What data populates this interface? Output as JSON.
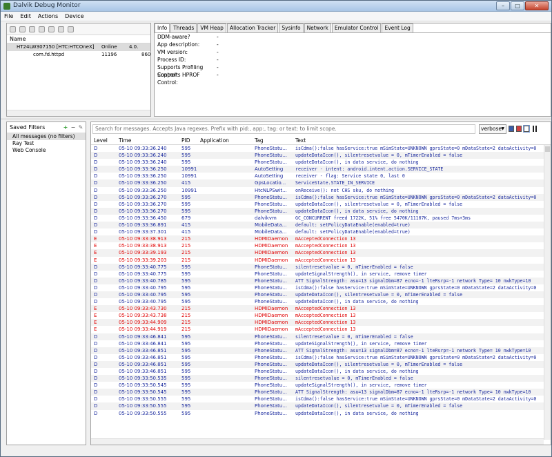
{
  "window": {
    "title": "Dalvik Debug Monitor",
    "buttons": [
      "–",
      "□",
      "✕"
    ]
  },
  "menu": [
    "File",
    "Edit",
    "Actions",
    "Device"
  ],
  "devices": {
    "header": "Name",
    "rows": [
      {
        "name": "HT24LW307150 [HTC:HTCOneX]",
        "status": "Online",
        "extra": "4.0.",
        "selected": true
      },
      {
        "name": "com.fd.httpd",
        "status": "11196",
        "extra": "860",
        "selected": false
      }
    ]
  },
  "tabs": [
    "Info",
    "Threads",
    "VM Heap",
    "Allocation Tracker",
    "Sysinfo",
    "Network",
    "Emulator Control",
    "Event Log"
  ],
  "info_props": [
    {
      "label": "DDM-aware?",
      "value": "-"
    },
    {
      "label": "App description:",
      "value": "-"
    },
    {
      "label": "VM version:",
      "value": "-"
    },
    {
      "label": "Process ID:",
      "value": "-"
    },
    {
      "label": "Supports Profiling Control:",
      "value": "-"
    },
    {
      "label": "Supports HPROF Control:",
      "value": "-"
    }
  ],
  "filters": {
    "title": "Saved Filters",
    "items": [
      "All messages (no filters)",
      "Ray Test",
      "Web Console"
    ]
  },
  "log": {
    "search_placeholder": "Search for messages. Accepts Java regexes. Prefix with pid:, app:, tag: or text: to limit scope.",
    "level_selected": "verbose",
    "columns": [
      "Level",
      "Time",
      "PID",
      "Application",
      "Tag",
      "Text"
    ],
    "colors": {
      "D": "#1a2a9e",
      "E": "#e00000"
    },
    "rows": [
      [
        "D",
        "05-10 09:33:36.240",
        "595",
        "",
        "PhoneStatu...",
        "isCdma():false hasService:true mSimState=UNKNOWN gprsState=0 mDataState=2 dataActivity=0"
      ],
      [
        "D",
        "05-10 09:33:36.240",
        "595",
        "",
        "PhoneStatu...",
        "updateDataIcon(), silentresetvalue = 0, mTimerEnabled = false"
      ],
      [
        "D",
        "05-10 09:33:36.240",
        "595",
        "",
        "PhoneStatu...",
        "updateDataIcon(), in data service, do nothing"
      ],
      [
        "D",
        "05-10 09:33:36.250",
        "10991",
        "",
        "AutoSetting",
        "receiver - intent: android.intent.action.SERVICE_STATE"
      ],
      [
        "D",
        "05-10 09:33:36.250",
        "10991",
        "",
        "AutoSetting",
        "receiver - flag: Service state 0, last 0"
      ],
      [
        "D",
        "05-10 09:33:36.250",
        "415",
        "",
        "GpsLocatio...",
        "ServiceState.STATE_IN_SERVICE"
      ],
      [
        "D",
        "05-10 09:33:36.250",
        "10991",
        "",
        "HtcNLPSwit...",
        "onReceive(): not CHS sku, do nothing"
      ],
      [
        "D",
        "05-10 09:33:36.270",
        "595",
        "",
        "PhoneStatu...",
        "isCdma():false hasService:true mSimState=UNKNOWN gprsState=0 mDataState=2 dataActivity=0"
      ],
      [
        "D",
        "05-10 09:33:36.270",
        "595",
        "",
        "PhoneStatu...",
        "updateDataIcon(), silentresetvalue = 0, mTimerEnabled = false"
      ],
      [
        "D",
        "05-10 09:33:36.270",
        "595",
        "",
        "PhoneStatu...",
        "updateDataIcon(), in data service, do nothing"
      ],
      [
        "D",
        "05-10 09:33:36.450",
        "679",
        "",
        "dalvikvm",
        "GC_CONCURRENT freed 1722K, 51% free 5470K/11107K, paused 7ms+3ms"
      ],
      [
        "D",
        "05-10 09:33:36.891",
        "415",
        "",
        "MobileData...",
        "default: setPolicyDataEnable(enabled=true)"
      ],
      [
        "D",
        "05-10 09:33:37.301",
        "415",
        "",
        "MobileData...",
        "default: setPolicyDataEnable(enabled=true)"
      ],
      [
        "E",
        "05-10 09:33:38.913",
        "215",
        "",
        "HDMIDaemon",
        "mAcceptedConnection 13"
      ],
      [
        "E",
        "05-10 09:33:38.913",
        "215",
        "",
        "HDMIDaemon",
        "mAcceptedConnection 13"
      ],
      [
        "E",
        "05-10 09:33:39.193",
        "215",
        "",
        "HDMIDaemon",
        "mAcceptedConnection 13"
      ],
      [
        "E",
        "05-10 09:33:39.203",
        "215",
        "",
        "HDMIDaemon",
        "mAcceptedConnection 13"
      ],
      [
        "D",
        "05-10 09:33:40.775",
        "595",
        "",
        "PhoneStatu...",
        "silentresetvalue = 0, mTimerEnabled = false"
      ],
      [
        "D",
        "05-10 09:33:40.775",
        "595",
        "",
        "PhoneStatu...",
        "updateSignalStrength(), in service, remove timer"
      ],
      [
        "D",
        "05-10 09:33:40.785",
        "595",
        "",
        "PhoneStatu...",
        "ATT SignalStrength: asu=13 signalDbm=87 ecno=-1 lteRsrp=-1 network Type= 10 nwkType=10"
      ],
      [
        "D",
        "05-10 09:33:40.795",
        "595",
        "",
        "PhoneStatu...",
        "isCdma():false hasService:true mSimState=UNKNOWN gprsState=0 mDataState=2 dataActivity=0"
      ],
      [
        "D",
        "05-10 09:33:40.795",
        "595",
        "",
        "PhoneStatu...",
        "updateDataIcon(), silentresetvalue = 0, mTimerEnabled = false"
      ],
      [
        "D",
        "05-10 09:33:40.795",
        "595",
        "",
        "PhoneStatu...",
        "updateDataIcon(), in data service, do nothing"
      ],
      [
        "E",
        "05-10 09:33:43.730",
        "215",
        "",
        "HDMIDaemon",
        "mAcceptedConnection 13"
      ],
      [
        "E",
        "05-10 09:33:43.738",
        "215",
        "",
        "HDMIDaemon",
        "mAcceptedConnection 13"
      ],
      [
        "E",
        "05-10 09:33:44.909",
        "215",
        "",
        "HDMIDaemon",
        "mAcceptedConnection 13"
      ],
      [
        "E",
        "05-10 09:33:44.919",
        "215",
        "",
        "HDMIDaemon",
        "mAcceptedConnection 13"
      ],
      [
        "D",
        "05-10 09:33:46.841",
        "595",
        "",
        "PhoneStatu...",
        "silentresetvalue = 0, mTimerEnabled = false"
      ],
      [
        "D",
        "05-10 09:33:46.841",
        "595",
        "",
        "PhoneStatu...",
        "updateSignalStrength(), in service, remove timer"
      ],
      [
        "D",
        "05-10 09:33:46.851",
        "595",
        "",
        "PhoneStatu...",
        "ATT SignalStrength: asu=13 signalDbm=87 ecno=-1 lteRsrp=-1 network Type= 10 nwkType=10"
      ],
      [
        "D",
        "05-10 09:33:46.851",
        "595",
        "",
        "PhoneStatu...",
        "isCdma():false hasService:true mSimState=UNKNOWN gprsState=0 mDataState=2 dataActivity=0"
      ],
      [
        "D",
        "05-10 09:33:46.851",
        "595",
        "",
        "PhoneStatu...",
        "updateDataIcon(), silentresetvalue = 0, mTimerEnabled = false"
      ],
      [
        "D",
        "05-10 09:33:46.851",
        "595",
        "",
        "PhoneStatu...",
        "updateDataIcon(), in data service, do nothing"
      ],
      [
        "D",
        "05-10 09:33:50.535",
        "595",
        "",
        "PhoneStatu...",
        "silentresetvalue = 0, mTimerEnabled = false"
      ],
      [
        "D",
        "05-10 09:33:50.545",
        "595",
        "",
        "PhoneStatu...",
        "updateSignalStrength(), in service, remove timer"
      ],
      [
        "D",
        "05-10 09:33:50.545",
        "595",
        "",
        "PhoneStatu...",
        "ATT SignalStrength: asu=13 signalDbm=87 ecno=-1 lteRsrp=-1 network Type= 10 nwkType=10"
      ],
      [
        "D",
        "05-10 09:33:50.555",
        "595",
        "",
        "PhoneStatu...",
        "isCdma():false hasService:true mSimState=UNKNOWN gprsState=0 mDataState=2 dataActivity=0"
      ],
      [
        "D",
        "05-10 09:33:50.555",
        "595",
        "",
        "PhoneStatu...",
        "updateDataIcon(), silentresetvalue = 0, mTimerEnabled = false"
      ],
      [
        "D",
        "05-10 09:33:50.555",
        "595",
        "",
        "PhoneStatu...",
        "updateDataIcon(), in data service, do nothing"
      ]
    ]
  }
}
